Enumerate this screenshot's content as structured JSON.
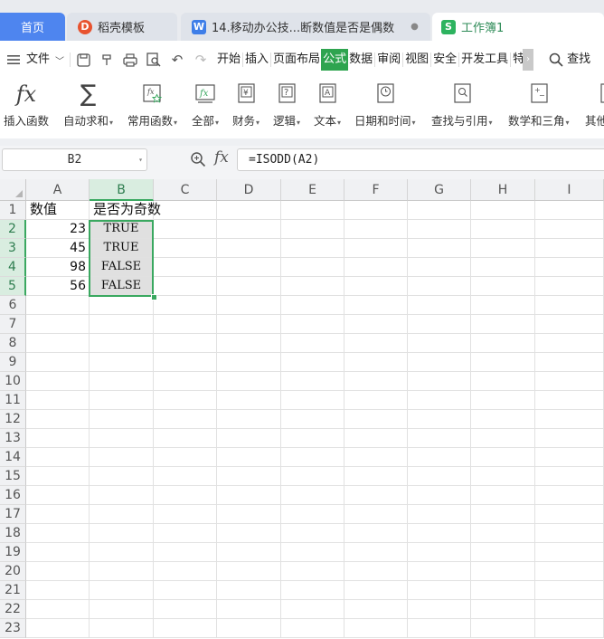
{
  "tabs": [
    {
      "label": "首页",
      "icon": ""
    },
    {
      "label": "稻壳模板",
      "icon": "docer-icon"
    },
    {
      "label": "14.移动办公技...断数值是否是偶数",
      "icon": "word-doc-icon",
      "dot": "●"
    },
    {
      "label": "工作簿1",
      "icon": "spreadsheet-icon"
    }
  ],
  "menu": {
    "file": "文件",
    "items": [
      "开始",
      "插入",
      "页面布局",
      "公式",
      "数据",
      "审阅",
      "视图",
      "安全",
      "开发工具",
      "特"
    ],
    "active": "公式",
    "search": "查找"
  },
  "ribbon": [
    {
      "label": "插入函数",
      "icon": "fx-icon"
    },
    {
      "label": "自动求和",
      "icon": "sigma-icon",
      "dropdown": true
    },
    {
      "label": "常用函数",
      "icon": "star-fx-icon",
      "dropdown": true
    },
    {
      "label": "全部",
      "icon": "fx-box-icon",
      "dropdown": true
    },
    {
      "label": "财务",
      "icon": "yen-book-icon",
      "dropdown": true
    },
    {
      "label": "逻辑",
      "icon": "question-book-icon",
      "dropdown": true
    },
    {
      "label": "文本",
      "icon": "text-book-icon",
      "dropdown": true
    },
    {
      "label": "日期和时间",
      "icon": "clock-book-icon",
      "dropdown": true
    },
    {
      "label": "查找与引用",
      "icon": "search-book-icon",
      "dropdown": true
    },
    {
      "label": "数学和三角",
      "icon": "math-book-icon",
      "dropdown": true
    },
    {
      "label": "其他",
      "icon": "more-book-icon"
    }
  ],
  "formula_bar": {
    "name_box": "B2",
    "fx": "fx",
    "formula": "=ISODD(A2)"
  },
  "sheet": {
    "columns": [
      "A",
      "B",
      "C",
      "D",
      "E",
      "F",
      "G",
      "H",
      "I"
    ],
    "rows": [
      "1",
      "2",
      "3",
      "4",
      "5",
      "6",
      "7",
      "8",
      "9",
      "10",
      "11",
      "12",
      "13",
      "14",
      "15",
      "16",
      "17",
      "18",
      "19",
      "20",
      "21",
      "22",
      "23"
    ],
    "selected_column": "B",
    "selected_rows": [
      "2",
      "3",
      "4",
      "5"
    ],
    "header_row": {
      "A": "数值",
      "B": "是否为奇数"
    },
    "data": [
      {
        "A": "23",
        "B": "TRUE"
      },
      {
        "A": "45",
        "B": "TRUE"
      },
      {
        "A": "98",
        "B": "FALSE"
      },
      {
        "A": "56",
        "B": "FALSE"
      }
    ]
  },
  "colors": {
    "accent_green": "#3aa860",
    "home_tab_blue": "#4e85ef"
  }
}
